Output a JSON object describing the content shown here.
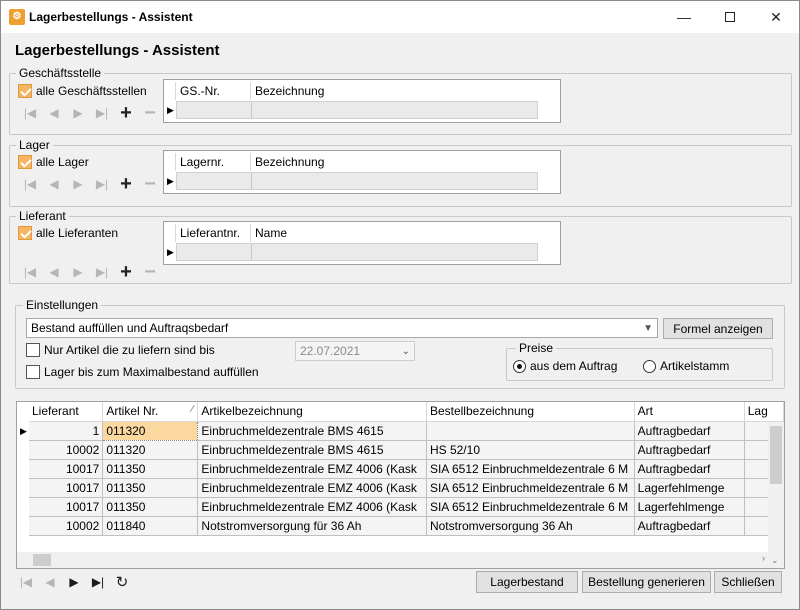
{
  "window": {
    "title": "Lagerbestellungs - Assistent",
    "icon": "app-icon"
  },
  "heading": "Lagerbestellungs - Assistent",
  "geschaeftsstelle": {
    "label": "Geschäftsstelle",
    "checkbox": "alle Geschäftsstellen",
    "checked": true,
    "columns": [
      "GS.-Nr.",
      "Bezeichnung"
    ]
  },
  "lager": {
    "label": "Lager",
    "checkbox": "alle Lager",
    "checked": true,
    "columns": [
      "Lagernr.",
      "Bezeichnung"
    ]
  },
  "lieferant": {
    "label": "Lieferant",
    "checkbox": "alle Lieferanten",
    "checked": true,
    "columns": [
      "Lieferantnr.",
      "Name"
    ]
  },
  "einstellungen": {
    "label": "Einstellungen",
    "mode": "Bestand auffüllen und Auftraqsbedarf",
    "formel_button": "Formel anzeigen",
    "nur_artikel": "Nur Artikel die zu liefern sind bis",
    "date": "22.07.2021",
    "lager_max": "Lager bis zum Maximalbestand auffüllen",
    "preise": {
      "label": "Preise",
      "opt1": "aus dem Auftrag",
      "opt2": "Artikelstamm",
      "selected": "aus dem Auftrag"
    }
  },
  "grid": {
    "columns": [
      "Lieferant",
      "Artikel Nr.",
      "Artikelbezeichnung",
      "Bestellbezeichnung",
      "Art",
      "Lag"
    ],
    "rows": [
      [
        "1",
        "011320",
        "Einbruchmeldezentrale BMS 4615",
        "",
        "Auftragbedarf"
      ],
      [
        "10002",
        "011320",
        "Einbruchmeldezentrale BMS 4615",
        "HS 52/10",
        "Auftragbedarf"
      ],
      [
        "10017",
        "011350",
        "Einbruchmeldezentrale EMZ 4006 (Kask",
        "SIA 6512 Einbruchmeldezentrale 6 M",
        "Auftragbedarf"
      ],
      [
        "10017",
        "011350",
        "Einbruchmeldezentrale EMZ 4006 (Kask",
        "SIA 6512 Einbruchmeldezentrale 6 M",
        "Lagerfehlmenge"
      ],
      [
        "10017",
        "011350",
        "Einbruchmeldezentrale EMZ 4006 (Kask",
        "SIA 6512 Einbruchmeldezentrale 6 M",
        "Lagerfehlmenge"
      ],
      [
        "10002",
        "011840",
        "Notstromversorgung für 36 Ah",
        "Notstromversorgung 36 Ah",
        "Auftragbedarf"
      ]
    ]
  },
  "buttons": {
    "lagerbestand": "Lagerbestand",
    "generieren": "Bestellung generieren",
    "schliessen": "Schließen"
  },
  "colors": {
    "accent": "#f5b562",
    "selected_cell": "#fbd8a0"
  }
}
